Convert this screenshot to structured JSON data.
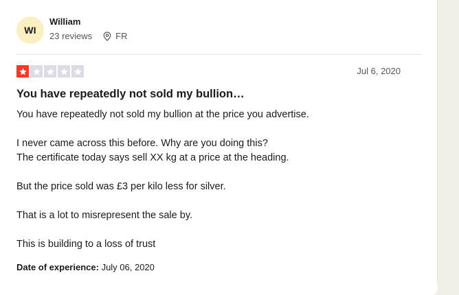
{
  "reviewer": {
    "initials": "WI",
    "name": "William",
    "review_count": "23 reviews",
    "location": "FR",
    "avatar_color": "#fcf0c3"
  },
  "review": {
    "rating": 1,
    "max_rating": 5,
    "star_filled_color": "#ff3722",
    "star_empty_color": "#dcdce6",
    "date": "Jul 6, 2020",
    "title": "You have repeatedly not sold my bullion…",
    "body": {
      "p1": "You have repeatedly not sold my bullion at the price you advertise.",
      "p2_line1": "I never came across this before. Why are you doing this?",
      "p2_line2": "The certificate today says sell XX kg at a price at the heading.",
      "p3": "But the price sold was £3 per kilo less for silver.",
      "p4": "That is a lot to misrepresent the sale by.",
      "p5": "This is building to a loss of trust"
    },
    "experience_label": "Date of experience:",
    "experience_date": "July 06, 2020"
  },
  "icons": {
    "location": "location-pin-icon",
    "star": "star-icon"
  }
}
